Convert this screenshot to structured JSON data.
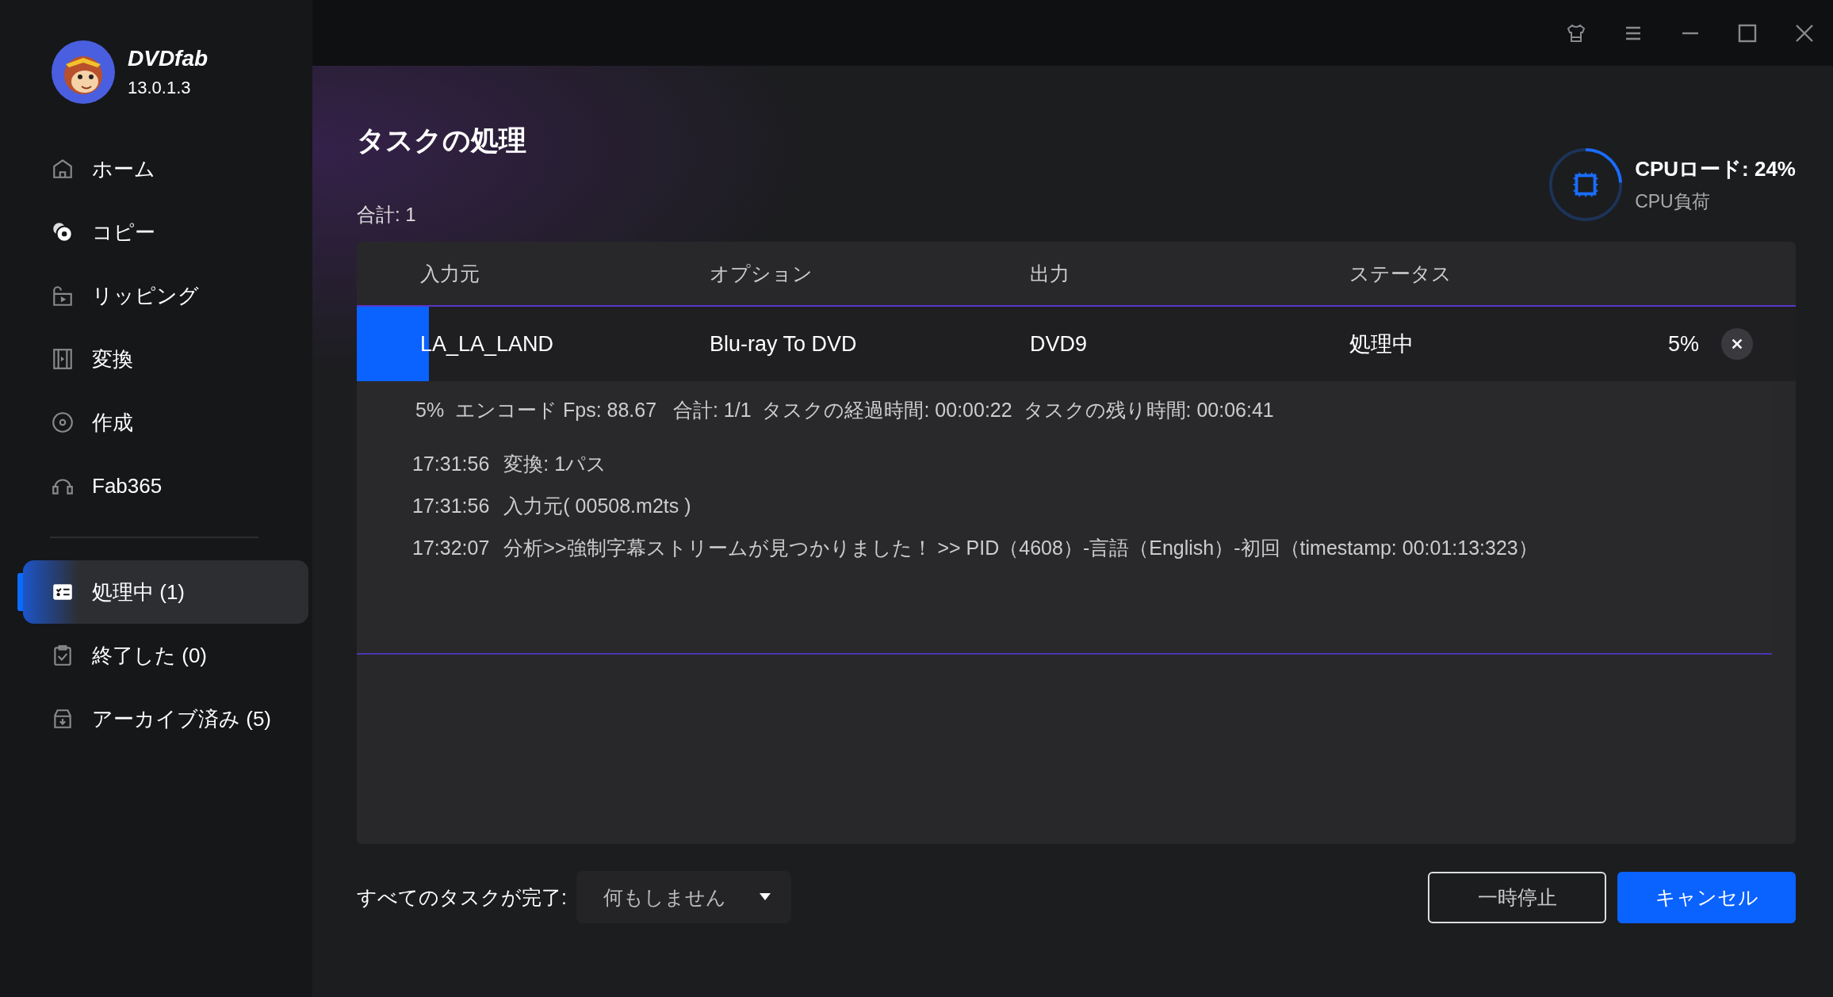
{
  "app": {
    "name": "DVDfab",
    "version": "13.0.1.3"
  },
  "sidebar": {
    "items": [
      {
        "label": "ホーム",
        "selected": false
      },
      {
        "label": "コピー",
        "selected": false
      },
      {
        "label": "リッピング",
        "selected": false
      },
      {
        "label": "変換",
        "selected": false
      },
      {
        "label": "作成",
        "selected": false
      },
      {
        "label": "Fab365",
        "selected": false
      }
    ],
    "task_items": [
      {
        "label": "処理中 (1)",
        "selected": true
      },
      {
        "label": "終了した (0)",
        "selected": false
      },
      {
        "label": "アーカイブ済み (5)",
        "selected": false
      }
    ]
  },
  "page": {
    "title": "タスクの処理",
    "total": "合計: 1"
  },
  "cpu": {
    "label": "CPUロード: 24%",
    "sublabel": "CPU負荷",
    "level": 0.24
  },
  "table": {
    "columns": [
      "入力元",
      "オプション",
      "出力",
      "ステータス"
    ],
    "rows": [
      {
        "source": "LA_LA_LAND",
        "option": "Blu-ray To DVD",
        "output": "DVD9",
        "status": "処理中",
        "percent": "5%",
        "level": 0.05,
        "expanded": true,
        "summary": "5%  エンコード Fps: 88.67   合計: 1/1  タスクの経過時間: 00:00:22  タスクの残り時間: 00:06:41",
        "log": [
          {
            "time": "17:31:56",
            "message": "変換: 1パス"
          },
          {
            "time": "17:31:56",
            "message": "入力元( 00508.m2ts )"
          },
          {
            "time": "17:32:07",
            "message": "分析>>強制字幕ストリームが見つかりました！ >> PID（4608）-言語（English）-初回（timestamp: 00:01:13:323）"
          }
        ]
      }
    ]
  },
  "footer": {
    "label": "すべてのタスクが完了:",
    "dropdown": "何もしません",
    "buttons": [
      {
        "label": "一時停止",
        "kind": "secondary"
      },
      {
        "label": "キャンセル",
        "kind": "primary"
      }
    ]
  }
}
